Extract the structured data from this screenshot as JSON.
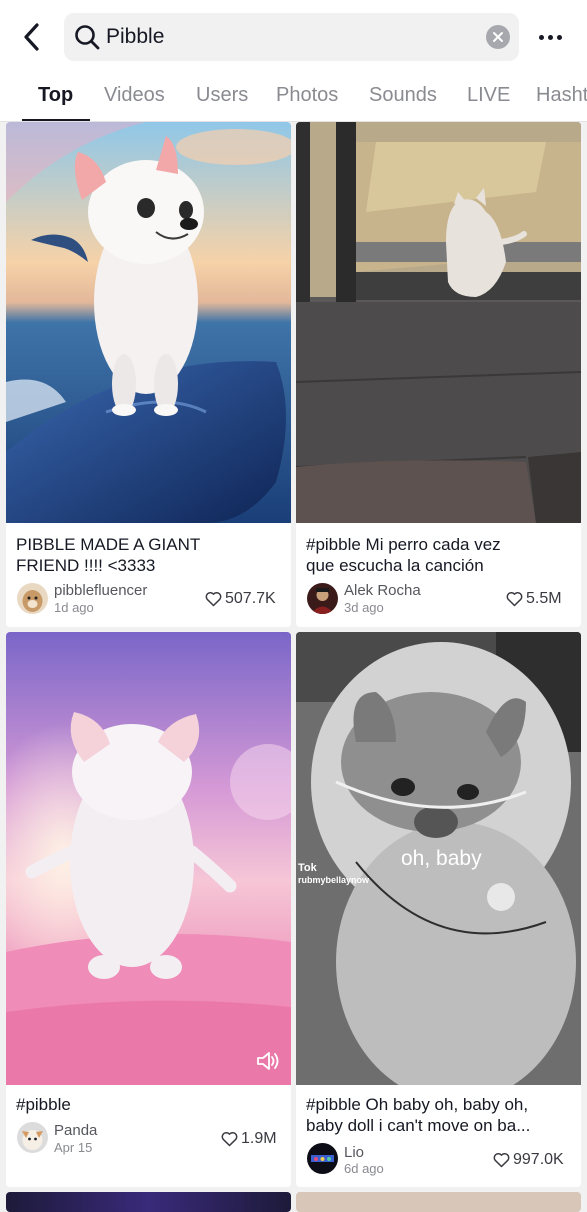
{
  "search": {
    "query": "Pibble"
  },
  "tabs": [
    "Top",
    "Videos",
    "Users",
    "Photos",
    "Sounds",
    "LIVE",
    "Hashtags"
  ],
  "active_tab": "Top",
  "results": [
    {
      "title_line1": "PIBBLE MADE A GIANT",
      "title_line2": "FRIEND !!!!  <3333",
      "author": "pibblefluencer",
      "date": "1d ago",
      "likes": "507.7K"
    },
    {
      "title_line1": "#pibble Mi perro cada vez",
      "title_line2": "que escucha la canción",
      "author": "Alek Rocha",
      "date": "3d ago",
      "likes": "5.5M"
    },
    {
      "title_line1": "#pibble",
      "title_line2": "",
      "author": "Panda",
      "date": "Apr 15",
      "likes": "1.9M"
    },
    {
      "title_line1": "#pibble Oh baby oh, baby oh,",
      "title_line2": "baby doll i can't move on ba...",
      "author": "Lio",
      "date": "6d ago",
      "likes": "997.0K",
      "overlay_caption": "oh, baby",
      "overlay_watermark": "Tok",
      "overlay_handle": "rubmybellaynow"
    }
  ]
}
